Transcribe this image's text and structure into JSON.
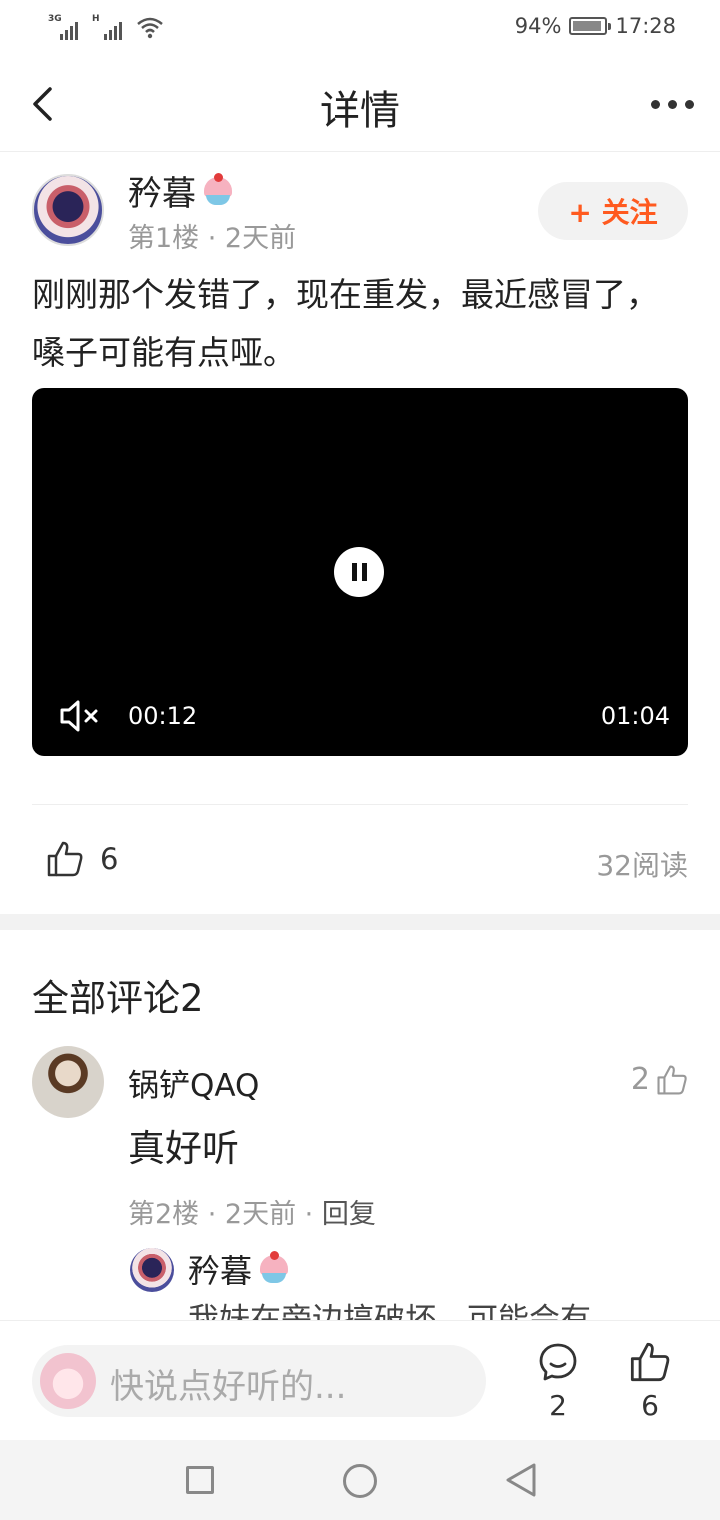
{
  "status_bar": {
    "network1": "3G",
    "network2": "H",
    "battery": "94%",
    "battery_level": 0.94,
    "time": "17:28"
  },
  "nav": {
    "title": "详情",
    "back_icon": "chevron-left-icon",
    "more_icon": "more-dots-icon"
  },
  "post": {
    "author": "矜暮",
    "author_emoji": "shaved-ice-emoji",
    "meta": "第1楼 · 2天前",
    "follow_label": "+ 关注",
    "text": "刚刚那个发错了，现在重发，最近感冒了，嗓子可能有点哑。",
    "video": {
      "current_time": "00:12",
      "total_time": "01:04",
      "state": "playing",
      "muted": true
    },
    "likes": "6",
    "reads": "32阅读"
  },
  "comments": {
    "title": "全部评论2",
    "items": [
      {
        "user": "锅铲QAQ",
        "likes": "2",
        "text": "真好听",
        "meta": "第2楼 · 2天前 · ",
        "reply_label": "回复",
        "replies": [
          {
            "user": "矜暮",
            "text": "我妹在旁边搞破坏，可能会有"
          }
        ]
      }
    ]
  },
  "bottom_bar": {
    "placeholder": "快说点好听的...",
    "comment_count": "2",
    "like_count": "6"
  },
  "colors": {
    "accent": "#ff5a1f",
    "muted_text": "#999999",
    "video_bg": "#000000"
  }
}
